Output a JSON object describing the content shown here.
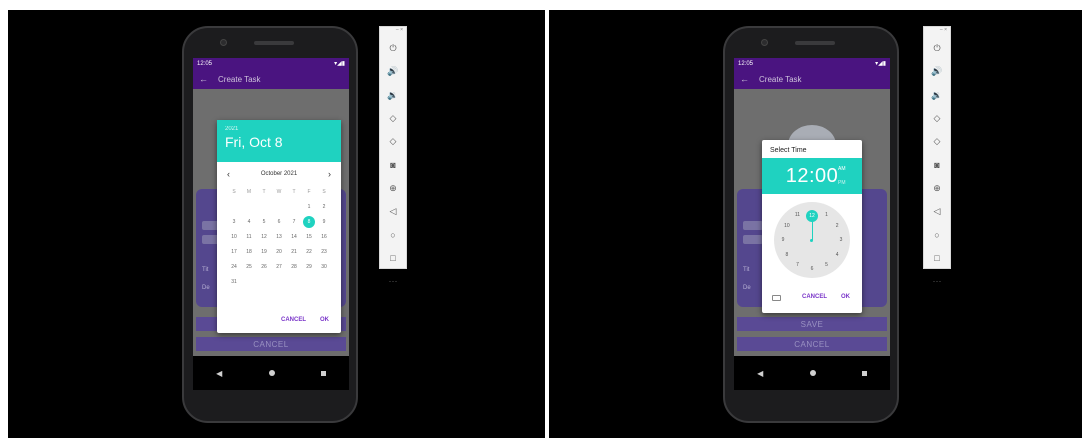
{
  "status_bar": {
    "time": "12:05",
    "signal": "▾◢▮"
  },
  "app_bar": {
    "back_glyph": "←",
    "title": "Create Task"
  },
  "form": {
    "field_label_1": "Tit",
    "field_label_2": "De",
    "save_label": "SAVE",
    "cancel_label": "CANCEL"
  },
  "date_picker": {
    "year": "2021",
    "selected_date": "Fri, Oct 8",
    "month_label": "October 2021",
    "prev_glyph": "‹",
    "next_glyph": "›",
    "weekday_headers": [
      "S",
      "M",
      "T",
      "W",
      "T",
      "F",
      "S"
    ],
    "days": [
      "",
      "",
      "",
      "",
      "",
      "1",
      "2",
      "3",
      "4",
      "5",
      "6",
      "7",
      "8",
      "9",
      "10",
      "11",
      "12",
      "13",
      "14",
      "15",
      "16",
      "17",
      "18",
      "19",
      "20",
      "21",
      "22",
      "23",
      "24",
      "25",
      "26",
      "27",
      "28",
      "29",
      "30",
      "31",
      "",
      "",
      "",
      "",
      "",
      ""
    ],
    "selected_day": "8",
    "cancel_label": "CANCEL",
    "ok_label": "OK"
  },
  "time_picker": {
    "title": "Select Time",
    "time": "12:00",
    "am_label": "AM",
    "pm_label": "PM",
    "clock_numbers": [
      "12",
      "1",
      "2",
      "3",
      "4",
      "5",
      "6",
      "7",
      "8",
      "9",
      "10",
      "11"
    ],
    "selected_hour": "12",
    "cancel_label": "CANCEL",
    "ok_label": "OK"
  },
  "emulator_toolbar": {
    "window_controls": "– ×",
    "buttons": [
      {
        "name": "power-icon",
        "glyph": "⏻"
      },
      {
        "name": "volume-up-icon",
        "glyph": "🔊"
      },
      {
        "name": "volume-down-icon",
        "glyph": "🔉"
      },
      {
        "name": "rotate-left-icon",
        "glyph": "◇"
      },
      {
        "name": "rotate-right-icon",
        "glyph": "◇"
      },
      {
        "name": "screenshot-icon",
        "glyph": "◙"
      },
      {
        "name": "zoom-icon",
        "glyph": "⊕"
      },
      {
        "name": "back-icon",
        "glyph": "◁"
      },
      {
        "name": "home-icon",
        "glyph": "○"
      },
      {
        "name": "overview-icon",
        "glyph": "□"
      },
      {
        "name": "more-icon",
        "glyph": "⋯"
      }
    ]
  },
  "colors": {
    "accent": "#1fd2c0",
    "app_bar": "#4a1480",
    "dialog_action": "#7a35c9"
  }
}
